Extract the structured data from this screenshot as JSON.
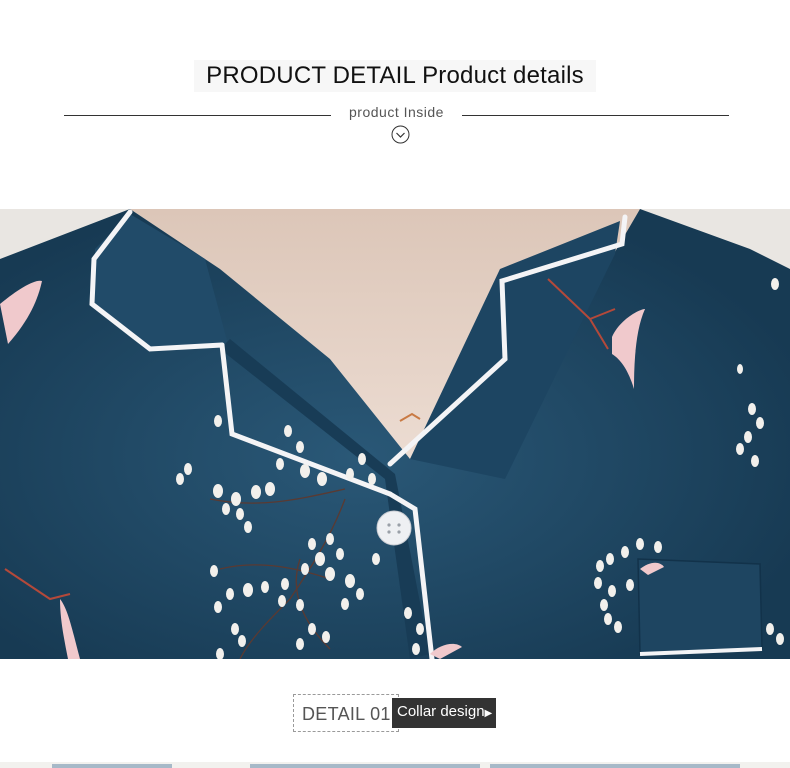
{
  "header": {
    "title": "PRODUCT DETAIL Product details",
    "subtitle": "product Inside",
    "scroll_icon": "chevron-down-circle-icon"
  },
  "detail": {
    "label": "DETAIL 01",
    "tag": "Collar design",
    "tag_icon": "play-triangle-icon"
  },
  "colors": {
    "fabric": "#1f4763",
    "piping": "#f4f4f6",
    "skin": "#e6d3c7",
    "tag_bg": "#333333",
    "leaf": "#f2f0ec",
    "blossom_pink": "#f0c9cc",
    "branch": "#b4493a"
  }
}
